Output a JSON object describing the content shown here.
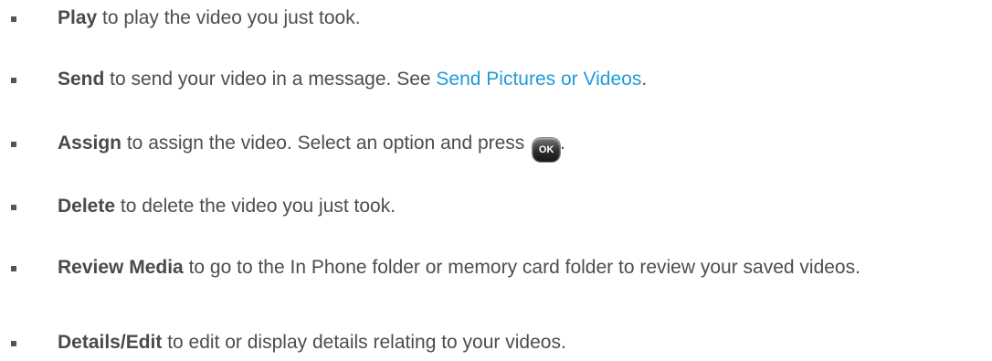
{
  "items": [
    {
      "term": "Play",
      "text": " to play the video you just took."
    },
    {
      "term": "Send",
      "text": " to send your video in a message. See ",
      "link": "Send Pictures or Videos",
      "after": "."
    },
    {
      "term": "Assign",
      "text": " to assign the video. Select an option and press ",
      "key": "OK",
      "after": "."
    },
    {
      "term": "Delete",
      "text": " to delete the video you just took."
    },
    {
      "term": "Review Media",
      "text": " to go to the In Phone folder or memory card folder to review your saved videos."
    },
    {
      "term": "Details/Edit",
      "text": " to edit or display details relating to your videos."
    }
  ],
  "colors": {
    "text": "#4d4d4d",
    "link": "#1f9bd7",
    "bullet": "#555555"
  },
  "icons": {
    "ok_key": "ok-button-icon",
    "bullet": "square-bullet-icon"
  }
}
